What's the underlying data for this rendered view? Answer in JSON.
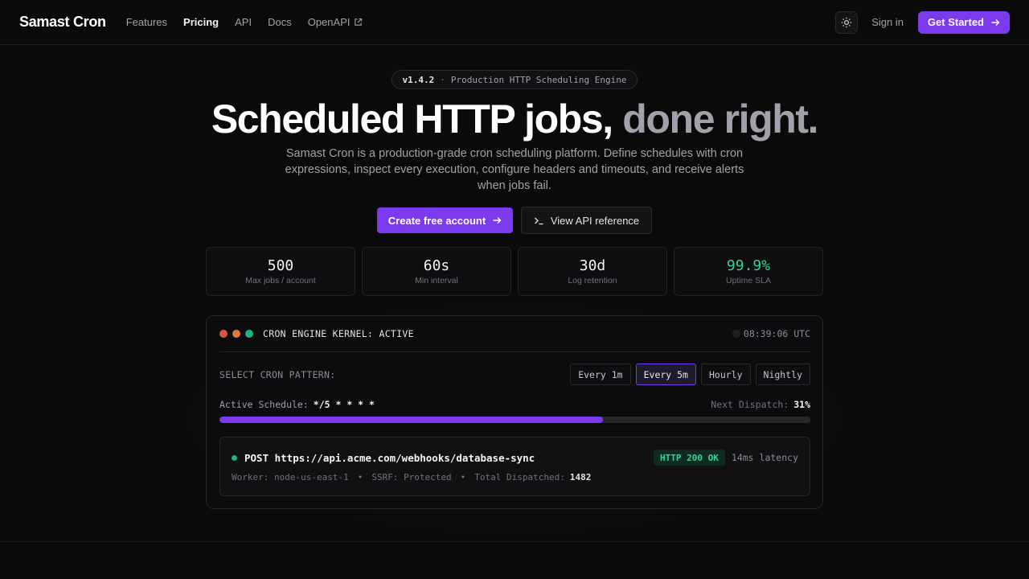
{
  "nav": {
    "brand": "Samast Cron",
    "links": [
      {
        "label": "Features"
      },
      {
        "label": "Pricing"
      },
      {
        "label": "API"
      },
      {
        "label": "Docs"
      },
      {
        "label": "OpenAPI"
      }
    ],
    "theme_icon": "sun-icon",
    "signin": "Sign in",
    "get_started": "Get Started"
  },
  "hero": {
    "badge_version": "v1.4.2",
    "badge_sep": "·",
    "badge_text": "Production HTTP Scheduling Engine",
    "headline_main": "Scheduled HTTP jobs,",
    "headline_dim": "done right.",
    "subtitle": "Samast Cron is a production-grade cron scheduling platform. Define schedules with cron expressions, inspect every execution, configure headers and timeouts, and receive alerts when jobs fail.",
    "cta_primary": "Create free account",
    "cta_secondary": "View API reference"
  },
  "stats": [
    {
      "value": "500",
      "label": "Max jobs / account"
    },
    {
      "value": "60s",
      "label": "Min interval"
    },
    {
      "value": "30d",
      "label": "Log retention"
    },
    {
      "value": "99.9%",
      "label": "Uptime SLA"
    }
  ],
  "console": {
    "kernel": "CRON ENGINE KERNEL: ACTIVE",
    "clock": "08:39:06 UTC",
    "pattern_label": "SELECT CRON PATTERN:",
    "patterns": [
      {
        "label": "Every 1m"
      },
      {
        "label": "Every 5m"
      },
      {
        "label": "Hourly"
      },
      {
        "label": "Nightly"
      }
    ],
    "selected_pattern": "Every 5m",
    "schedule_label": "Active Schedule:",
    "schedule_expr": "*/5 * * * *",
    "next_label": "Next Dispatch:",
    "next_value": "31%",
    "progress_fraction": 0.31,
    "job": {
      "request": "POST https://api.acme.com/webhooks/database-sync",
      "status": "HTTP 200 OK",
      "latency": "14ms latency",
      "worker": "Worker: node-us-east-1",
      "ssrf": "SSRF: Protected",
      "bullet": "•",
      "dispatched_label": "Total Dispatched:",
      "dispatched_count": "1482"
    }
  },
  "colors": {
    "accent": "#7c3aed",
    "success": "#34d399",
    "background": "#0a0a0b"
  }
}
